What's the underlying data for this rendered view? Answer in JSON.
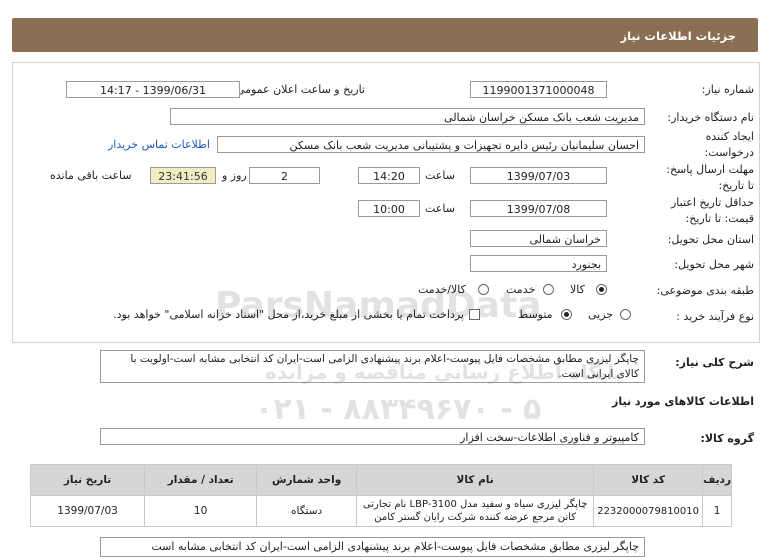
{
  "header": {
    "title": "جزئیات اطلاعات نیاز"
  },
  "form": {
    "need_number_label": "شماره نیاز:",
    "need_number": "1199001371000048",
    "announce_label": "تاریخ و ساعت اعلان عمومی:",
    "announce_value": "1399/06/31 - 14:17",
    "buyer_label": "نام دستگاه خریدار:",
    "buyer_value": "مدیریت شعب بانک مسکن خراسان شمالی",
    "creator_label_1": "ایجاد کننده",
    "creator_label_2": "درخواست:",
    "creator_value": "احسان  سلیمانیان رئیس دایره تجهیزات و پشتیبانی مدیریت شعب بانک مسکن",
    "contact_link": "اطلاعات تماس خریدار",
    "deadline_label_1": "مهلت ارسال پاسخ:",
    "deadline_label_2": "تا تاریخ:",
    "deadline_date": "1399/07/03",
    "time_label": "ساعت",
    "deadline_time": "14:20",
    "days_value": "2",
    "days_label": "روز و",
    "remaining_timer": "23:41:56",
    "remaining_label": "ساعت باقی مانده",
    "validity_label_1": "حداقل تاریخ اعتبار",
    "validity_label_2": "قیمت: تا تاریخ:",
    "validity_date": "1399/07/08",
    "validity_time": "10:00",
    "province_label": "استان محل تحویل:",
    "province_value": "خراسان شمالی",
    "city_label": "شهر محل تحویل:",
    "city_value": "بجنورد",
    "category_label": "طبقه بندی موضوعی:",
    "category_options": [
      "کالا",
      "خدمت",
      "کالا/خدمت"
    ],
    "category_selected": "کالا",
    "process_label": "نوع فرآیند خرید :",
    "process_options": [
      "جزیی",
      "متوسط"
    ],
    "process_selected": "متوسط",
    "payment_note": "پرداخت تمام یا بخشی از مبلغ خرید،از محل \"اسناد خزانه اسلامی\" خواهد بود."
  },
  "description": {
    "label": "شرح کلی نیاز:",
    "text": "چاپگر لیزری مطابق مشخصات فایل پیوست-اعلام برند پیشنهادی الزامی است-ایران کد انتخابی مشابه است-اولویت با کالای ایرانی است."
  },
  "goods": {
    "section_title": "اطلاعات کالاهای مورد نیاز",
    "group_label": "گروه کالا:",
    "group_value": "کامپیوتر و فناوری اطلاعات-سخت افزار",
    "columns": [
      "ردیف",
      "کد کالا",
      "نام کالا",
      "واحد شمارش",
      "تعداد / مقدار",
      "تاریخ نیاز"
    ],
    "rows": [
      {
        "row": "1",
        "code": "2232000079810010",
        "name": "چاپگر لیزری سیاه و سفید مدل LBP-3100 نام تجارتی کانن مرجع عرضه کننده شرکت رایان گستر کامن",
        "unit": "دستگاه",
        "qty": "10",
        "date": "1399/07/03"
      }
    ],
    "bottom_note": "چاپگر لیزری مطابق مشخصات فایل پیوست-اعلام برند پیشنهادی الزامی است-ایران کد انتخابی مشابه است"
  },
  "watermark": {
    "brand": "ParsNamadData",
    "line1": "پایگاه اطلاع رسانی مناقصه و مزایده",
    "phone": "۰۲۱ - ۸۸۳۴۹۶۷۰ - ۵"
  },
  "colors": {
    "header_bg": "#8b6f53",
    "timer_bg": "#f1edc2",
    "link": "#1a5cc0",
    "table_header": "#d6d6d6"
  }
}
